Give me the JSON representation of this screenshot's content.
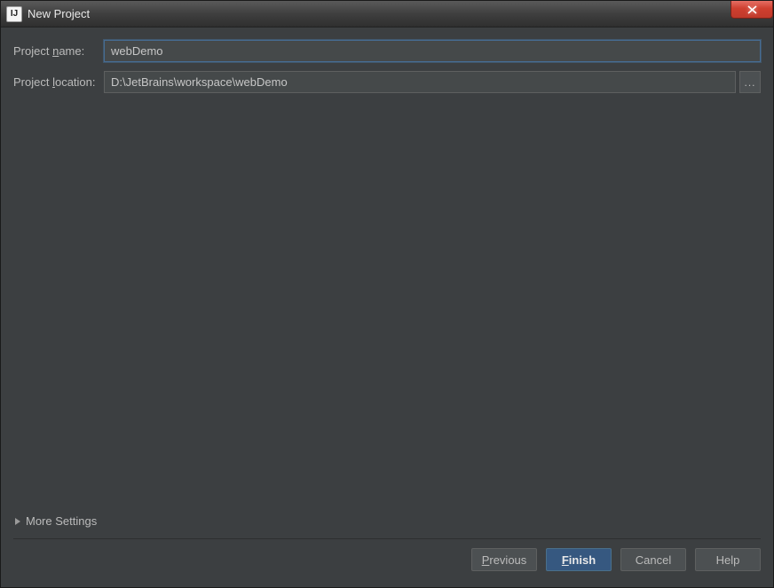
{
  "window": {
    "title": "New Project",
    "icon_text": "IJ"
  },
  "form": {
    "project_name": {
      "label_prefix": "Project ",
      "label_underline": "n",
      "label_suffix": "ame:",
      "value": "webDemo"
    },
    "project_location": {
      "label_prefix": "Project ",
      "label_underline": "l",
      "label_suffix": "ocation:",
      "value": "D:\\JetBrains\\workspace\\webDemo"
    },
    "browse_dots": "..."
  },
  "more_settings": {
    "label_prefix": "Mor",
    "label_underline": "e",
    "label_suffix": " Settings"
  },
  "buttons": {
    "previous_underline": "P",
    "previous_suffix": "revious",
    "finish_underline": "F",
    "finish_suffix": "inish",
    "cancel": "Cancel",
    "help": "Help"
  }
}
